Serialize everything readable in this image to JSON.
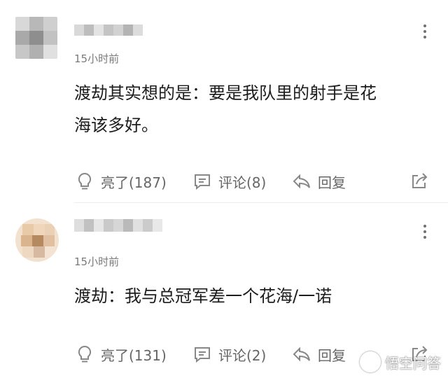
{
  "comments": [
    {
      "time": "15小时前",
      "text_lines": [
        "渡劫其实想的是：要是我队里的射手是花",
        "海该多好。"
      ],
      "likes": "亮了(187)",
      "replies": "评论(8)",
      "reply_label": "回复"
    },
    {
      "time": "15小时前",
      "text_lines": [
        "渡劫：我与总冠军差一个花海/一诺"
      ],
      "likes": "亮了(131)",
      "replies": "评论(2)",
      "reply_label": "回复"
    }
  ],
  "watermark": {
    "text": "悟空问答"
  },
  "colors": {
    "text_primary": "#1c1c1c",
    "text_secondary": "#7a7a7a",
    "action_gray": "#666666",
    "background": "#ffffff"
  },
  "icons": {
    "like": "lightbulb-icon",
    "comment": "speech-bubble-icon",
    "reply": "reply-arrow-icon",
    "share": "share-icon",
    "more": "vertical-dots-icon"
  }
}
